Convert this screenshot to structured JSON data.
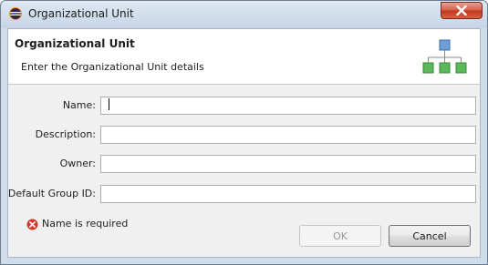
{
  "window": {
    "title": "Organizational Unit",
    "icons": {
      "app": "eclipse-icon",
      "close": "close-icon"
    }
  },
  "banner": {
    "title": "Organizational Unit",
    "message": "Enter the Organizational Unit details",
    "icon": "org-chart-icon",
    "icon_colors": {
      "top": "#6f9fd8",
      "children": "#5cb85c"
    }
  },
  "form": {
    "fields": [
      {
        "label": "Name:",
        "value": ""
      },
      {
        "label": "Description:",
        "value": ""
      },
      {
        "label": "Owner:",
        "value": ""
      },
      {
        "label": "Default Group ID:",
        "value": ""
      }
    ]
  },
  "status": {
    "message": "Name is required",
    "icon": "error-icon",
    "color": "#d9362b"
  },
  "buttons": {
    "ok": {
      "label": "OK",
      "enabled": false
    },
    "cancel": {
      "label": "Cancel",
      "enabled": true
    }
  }
}
